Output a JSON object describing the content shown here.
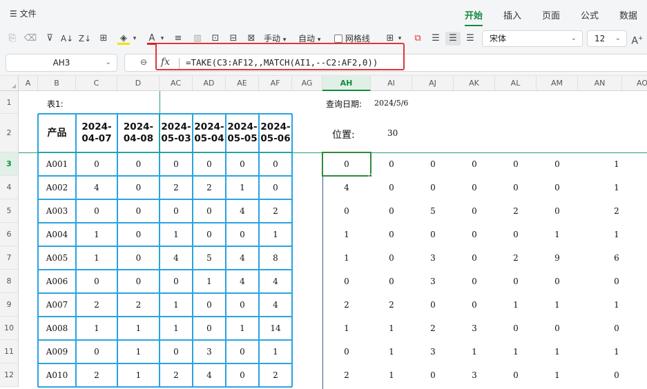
{
  "ribbon": {
    "file_label": "文件",
    "tabs": [
      "开始",
      "插入",
      "页面",
      "公式",
      "数据"
    ],
    "active_tab": "开始"
  },
  "toolbar": {
    "manual_label": "手动",
    "auto_label": "自动",
    "gridlines_label": "网格线",
    "font_name": "宋体",
    "font_size": "12",
    "font_color": "#e02020",
    "fill_color": "#f5e000"
  },
  "formula_bar": {
    "name_box": "AH3",
    "fx_label": "fx",
    "formula": "=TAKE(C3:AF12,,MATCH(AI1,--C2:AF2,0))"
  },
  "columns": [
    "A",
    "B",
    "C",
    "D",
    "AC",
    "AD",
    "AE",
    "AF",
    "AG",
    "AH",
    "AI",
    "AJ",
    "AK",
    "AL",
    "AM",
    "AN",
    "AO"
  ],
  "active_column": "AH",
  "rows": [
    "1",
    "2",
    "3",
    "4",
    "5",
    "6",
    "7",
    "8",
    "9",
    "10",
    "11",
    "12"
  ],
  "active_row": "3",
  "sheet": {
    "table_label": "表1:",
    "query_date_label": "查询日期:",
    "query_date": "2024/5/6",
    "position_label": "位置:",
    "position_value": "30",
    "product_header": "产品",
    "date_headers": [
      "2024-04-07",
      "2024-04-08",
      "2024-05-03",
      "2024-05-04",
      "2024-05-05",
      "2024-05-06"
    ],
    "products": [
      "A001",
      "A002",
      "A003",
      "A004",
      "A005",
      "A006",
      "A007",
      "A008",
      "A009",
      "A010"
    ],
    "left_values": [
      [
        "0",
        "0",
        "0",
        "0",
        "0",
        "0"
      ],
      [
        "4",
        "0",
        "2",
        "2",
        "1",
        "0"
      ],
      [
        "0",
        "0",
        "0",
        "0",
        "4",
        "2"
      ],
      [
        "1",
        "0",
        "1",
        "0",
        "0",
        "1"
      ],
      [
        "1",
        "0",
        "4",
        "5",
        "4",
        "8"
      ],
      [
        "0",
        "0",
        "0",
        "1",
        "4",
        "4"
      ],
      [
        "2",
        "2",
        "1",
        "0",
        "0",
        "4"
      ],
      [
        "1",
        "1",
        "1",
        "0",
        "1",
        "14"
      ],
      [
        "0",
        "1",
        "0",
        "3",
        "0",
        "1"
      ],
      [
        "2",
        "1",
        "2",
        "4",
        "0",
        "2"
      ]
    ],
    "right_values": [
      [
        "0",
        "0",
        "0",
        "0",
        "0",
        "0",
        "1"
      ],
      [
        "4",
        "0",
        "0",
        "0",
        "0",
        "0",
        "1"
      ],
      [
        "0",
        "0",
        "5",
        "0",
        "2",
        "0",
        "2"
      ],
      [
        "1",
        "0",
        "0",
        "0",
        "0",
        "1",
        "1"
      ],
      [
        "1",
        "0",
        "3",
        "0",
        "2",
        "9",
        "6"
      ],
      [
        "0",
        "0",
        "3",
        "0",
        "0",
        "0",
        "0"
      ],
      [
        "2",
        "2",
        "0",
        "0",
        "1",
        "1",
        "1"
      ],
      [
        "1",
        "1",
        "2",
        "3",
        "0",
        "0",
        "0"
      ],
      [
        "0",
        "1",
        "3",
        "1",
        "1",
        "1",
        "1"
      ],
      [
        "2",
        "1",
        "0",
        "3",
        "0",
        "1",
        "0"
      ]
    ]
  }
}
